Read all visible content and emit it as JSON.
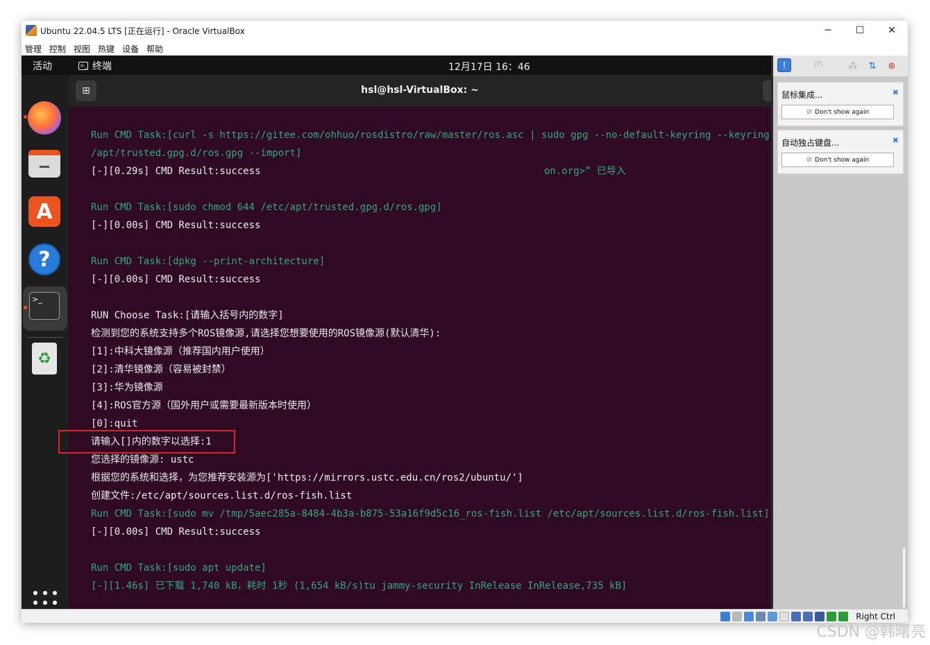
{
  "window": {
    "title": "Ubuntu 22.04.5 LTS [正在运行] - Oracle VirtualBox",
    "minimize": "─",
    "maximize": "☐",
    "close": "✕"
  },
  "menu": [
    "管理",
    "控制",
    "视图",
    "热键",
    "设备",
    "帮助"
  ],
  "topbar": {
    "activities": "活动",
    "app_name": "终端",
    "app_icon_glyph": ">_",
    "clock": "12月17日  16：46"
  },
  "dock": {
    "software_glyph": "A",
    "help_glyph": "?",
    "terminal_glyph": ">_",
    "trash_glyph": "♻"
  },
  "terminal": {
    "title": "hsl@hsl-VirtualBox: ~",
    "newtab_glyph": "⊞",
    "lines": [
      {
        "text": "Run CMD Task:[curl -s https://gitee.com/ohhuo/rosdistro/raw/master/ros.asc | sudo gpg --no-default-keyring --keyring",
        "color": "green"
      },
      {
        "text": "/apt/trusted.gpg.d/ros.gpg --import]",
        "color": "green"
      },
      {
        "text": "[-][0.29s] CMD Result:success",
        "color": "white"
      },
      {
        "text": "",
        "color": "white"
      },
      {
        "text": "Run CMD Task:[sudo chmod 644 /etc/apt/trusted.gpg.d/ros.gpg]",
        "color": "green"
      },
      {
        "text": "[-][0.00s] CMD Result:success",
        "color": "white"
      },
      {
        "text": "",
        "color": "white"
      },
      {
        "text": "Run CMD Task:[dpkg --print-architecture]",
        "color": "green"
      },
      {
        "text": "[-][0.00s] CMD Result:success",
        "color": "white"
      },
      {
        "text": "",
        "color": "white"
      },
      {
        "text": "RUN Choose Task:[请输入括号内的数字]",
        "color": "white"
      },
      {
        "text": "检测到您的系统支持多个ROS镜像源,请选择您想要使用的ROS镜像源(默认清华):",
        "color": "white"
      },
      {
        "text": "[1]:中科大镜像源（推荐国内用户使用）",
        "color": "white"
      },
      {
        "text": "[2]:清华镜像源（容易被封禁）",
        "color": "white"
      },
      {
        "text": "[3]:华为镜像源",
        "color": "white"
      },
      {
        "text": "[4]:ROS官方源（国外用户或需要最新版本时使用）",
        "color": "white"
      },
      {
        "text": "[0]:quit",
        "color": "white"
      },
      {
        "text": "请输入[]内的数字以选择:1",
        "color": "white"
      },
      {
        "text": "您选择的镜像源: ustc",
        "color": "white"
      },
      {
        "text": "根据您的系统和选择，为您推荐安装源为['https://mirrors.ustc.edu.cn/ros2/ubuntu/']",
        "color": "white"
      },
      {
        "text": "创建文件:/etc/apt/sources.list.d/ros-fish.list",
        "color": "white"
      },
      {
        "text": "Run CMD Task:[sudo mv /tmp/5aec285a-8484-4b3a-b875-53a16f9d5c16_ros-fish.list /etc/apt/sources.list.d/ros-fish.list]",
        "color": "green"
      },
      {
        "text": "[-][0.00s] CMD Result:success",
        "color": "white"
      },
      {
        "text": "",
        "color": "white"
      },
      {
        "text": "Run CMD Task:[sudo apt update]",
        "color": "green"
      },
      {
        "text": "[-][1.46s] 已下载 1,740 kB，耗时 1秒 (1,654 kB/s)tu jammy-security InRelease InRelease,735 kB]",
        "color": "green"
      }
    ],
    "overlay_fragment": "on.org>” 已导入"
  },
  "side_panel": {
    "lang": "zh",
    "notify_glyph": "!",
    "cards": [
      {
        "title": "鼠标集成...",
        "button": "Don't show again",
        "close": "✖"
      },
      {
        "title": "自动独占键盘...",
        "button": "Don't show again",
        "close": "✖"
      }
    ]
  },
  "statusbar": {
    "host_key": "Right Ctrl"
  },
  "watermark": "CSDN @韩曙亮",
  "colors": {
    "terminal_bg": "#300a24",
    "terminal_green": "#33a87a",
    "ubuntu_orange": "#e95420",
    "highlight_red": "#e0242a"
  }
}
